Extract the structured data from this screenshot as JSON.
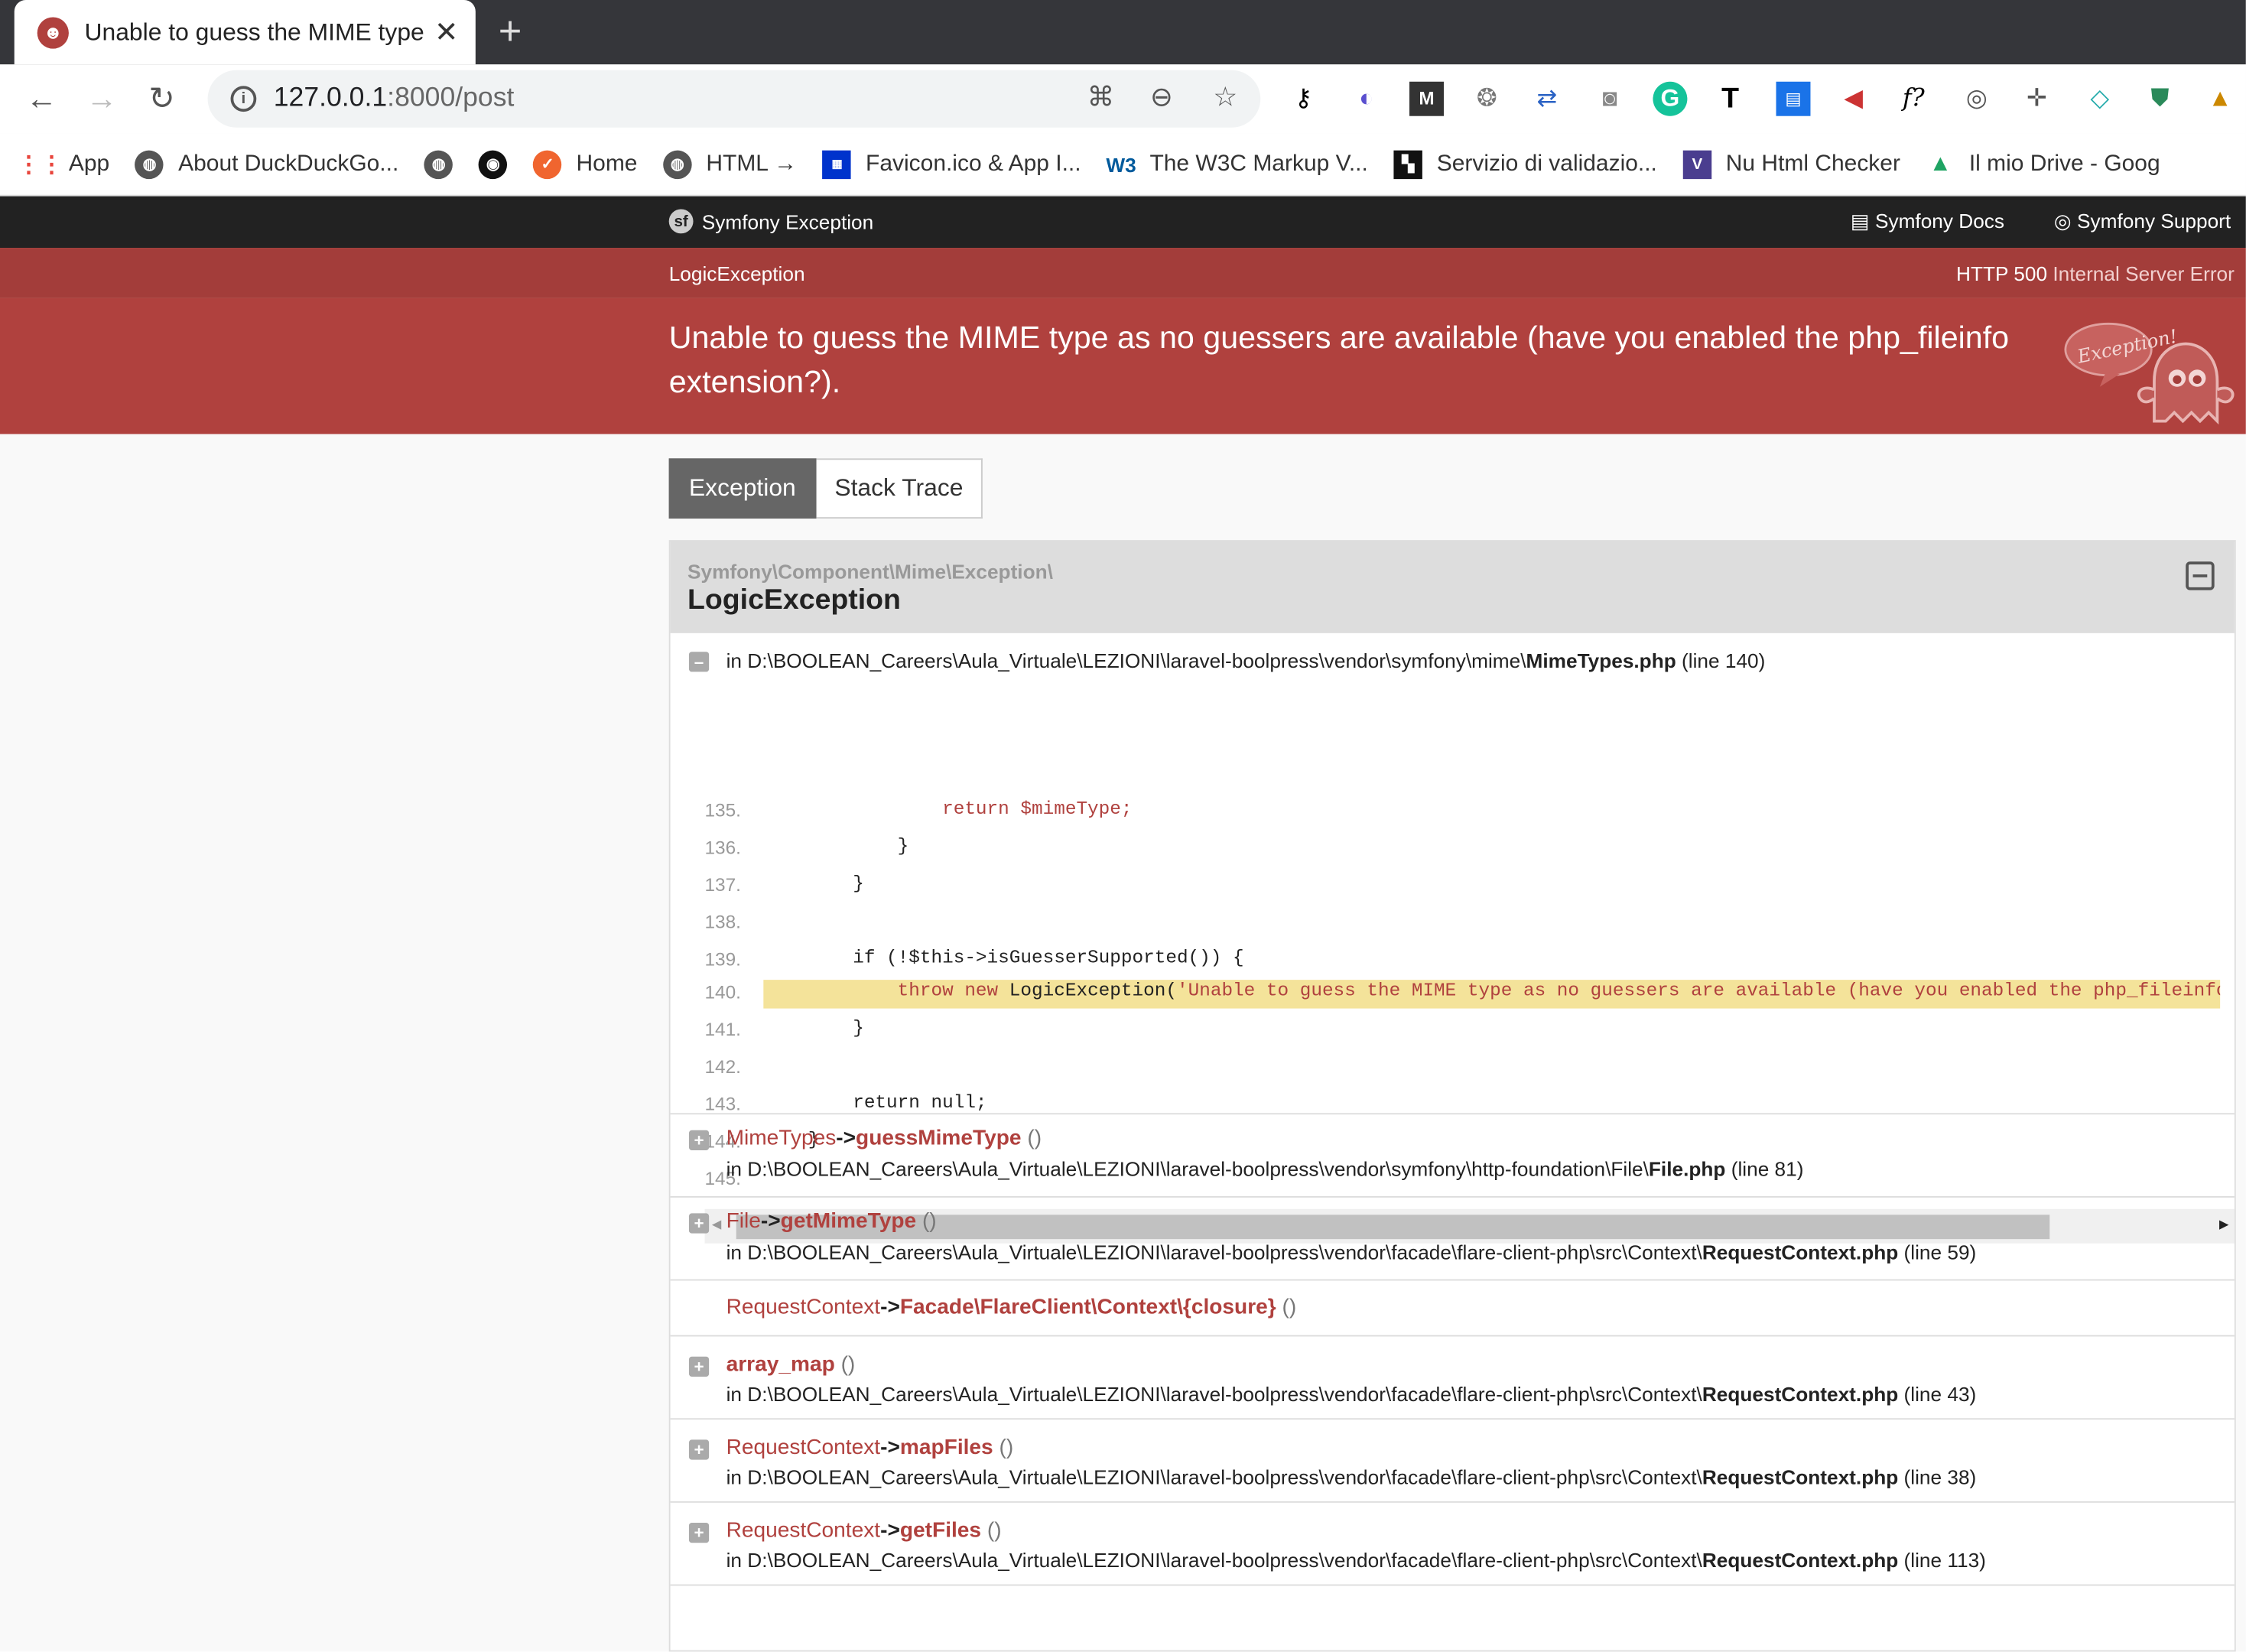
{
  "browser": {
    "tab_title": "Unable to guess the MIME type a",
    "url_host": "127.0.0.1",
    "url_rest": ":8000/post",
    "bookmarks": [
      "App",
      "About DuckDuckGo...",
      "Home",
      "HTML →",
      "Favicon.ico & App I...",
      "The W3C Markup V...",
      "Servizio di validazio...",
      "Nu Html Checker",
      "Il mio Drive - Goog"
    ]
  },
  "sf": {
    "brand": "Symfony Exception",
    "docs": "Symfony Docs",
    "support": "Symfony Support",
    "exception_class": "LogicException",
    "status_code": "HTTP 500",
    "status_text": "Internal Server Error",
    "message": "Unable to guess the MIME type as no guessers are available (have you enabled the php_fileinfo extension?).",
    "ghost_text": "Exception!"
  },
  "tabs": {
    "exception": "Exception",
    "stack_trace": "Stack Trace"
  },
  "exception": {
    "namespace": "Symfony\\Component\\Mime\\Exception\\",
    "class": "LogicException",
    "file_prefix": "in D:\\BOOLEAN_Careers\\Aula_Virtuale\\LEZIONI\\laravel-boolpress\\vendor\\symfony\\mime\\",
    "file_name": "MimeTypes.php",
    "file_line": "(line 140)",
    "lines": [
      "135.",
      "136.",
      "137.",
      "138.",
      "139.",
      "140.",
      "141.",
      "142.",
      "143.",
      "144.",
      "145."
    ]
  },
  "code": {
    "l135": "                return $mimeType;",
    "l136": "            }",
    "l137": "        }",
    "l138": "",
    "l139_a": "        if (!$this->isGuesserSupported()) {",
    "l140_kw": "            throw new ",
    "l140_cls": "LogicException(",
    "l140_str": "'Unable to guess the MIME type as no guessers are available (have you enabled the php_fileinfo extension?).'",
    "l141": "        }",
    "l142": "",
    "l143": "        return null;",
    "l144": "    }",
    "l145": ""
  },
  "trace": [
    {
      "cls": "MimeTypes",
      "arrow": "->",
      "fn": "guessMimeType",
      "paren": "()",
      "path": "in D:\\BOOLEAN_Careers\\Aula_Virtuale\\LEZIONI\\laravel-boolpress\\vendor\\symfony\\http-foundation\\File\\",
      "file": "File.php",
      "line": "(line 81)"
    },
    {
      "cls": "File",
      "arrow": "->",
      "fn": "getMimeType",
      "paren": "()",
      "path": "in D:\\BOOLEAN_Careers\\Aula_Virtuale\\LEZIONI\\laravel-boolpress\\vendor\\facade\\flare-client-php\\src\\Context\\",
      "file": "RequestContext.php",
      "line": "(line 59)"
    },
    {
      "cls": "RequestContext",
      "arrow": "->",
      "fn": "Facade\\FlareClient\\Context\\{closure}",
      "paren": "()"
    },
    {
      "fn": "array_map",
      "paren": "()",
      "path": "in D:\\BOOLEAN_Careers\\Aula_Virtuale\\LEZIONI\\laravel-boolpress\\vendor\\facade\\flare-client-php\\src\\Context\\",
      "file": "RequestContext.php",
      "line": "(line 43)"
    },
    {
      "cls": "RequestContext",
      "arrow": "->",
      "fn": "mapFiles",
      "paren": "()",
      "path": "in D:\\BOOLEAN_Careers\\Aula_Virtuale\\LEZIONI\\laravel-boolpress\\vendor\\facade\\flare-client-php\\src\\Context\\",
      "file": "RequestContext.php",
      "line": "(line 38)"
    },
    {
      "cls": "RequestContext",
      "arrow": "->",
      "fn": "getFiles",
      "paren": "()",
      "path": "in D:\\BOOLEAN_Careers\\Aula_Virtuale\\LEZIONI\\laravel-boolpress\\vendor\\facade\\flare-client-php\\src\\Context\\",
      "file": "RequestContext.php",
      "line": "(line 113)"
    }
  ]
}
